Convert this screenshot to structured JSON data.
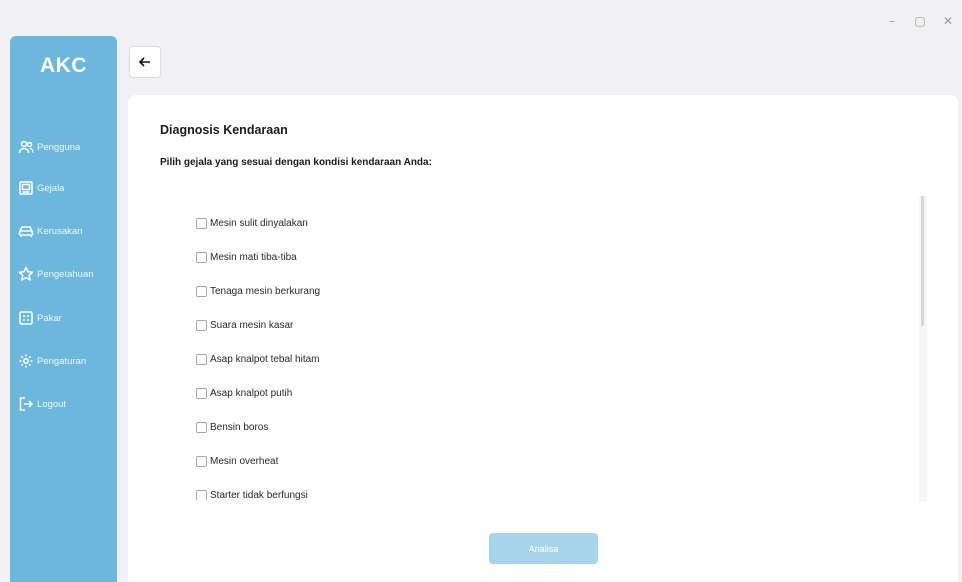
{
  "window": {
    "controls": [
      "–",
      "▢",
      "✕"
    ]
  },
  "sidebar": {
    "logo": "AKC",
    "items": [
      {
        "label": "Pengguna",
        "icon": "users-icon"
      },
      {
        "label": "Gejala",
        "icon": "clipboard-icon"
      },
      {
        "label": "Kerusakan",
        "icon": "car-icon"
      },
      {
        "label": "Pengetahuan",
        "icon": "star-icon"
      },
      {
        "label": "Pakar",
        "icon": "calculator-icon"
      },
      {
        "label": "Pengaturan",
        "icon": "gear-icon"
      },
      {
        "label": "Logout",
        "icon": "logout-icon"
      }
    ]
  },
  "main": {
    "title": "Diagnosis Kendaraan",
    "subtitle": "Pilih gejala yang sesuai dengan kondisi kendaraan Anda:",
    "symptoms": [
      {
        "label": "Mesin sulit dinyalakan",
        "checked": false
      },
      {
        "label": "Mesin mati tiba-tiba",
        "checked": false
      },
      {
        "label": "Tenaga mesin berkurang",
        "checked": false
      },
      {
        "label": "Suara mesin kasar",
        "checked": false
      },
      {
        "label": "Asap knalpot tebal hitam",
        "checked": false
      },
      {
        "label": "Asap knalpot putih",
        "checked": false
      },
      {
        "label": "Bensin boros",
        "checked": false
      },
      {
        "label": "Mesin overheat",
        "checked": false
      },
      {
        "label": "Starter tidak berfungsi",
        "checked": false
      }
    ],
    "analyze_label": "Analisa"
  },
  "colors": {
    "sidebar": "#6cb7dc",
    "button": "#a6d4ec",
    "background": "#f1f1f3"
  }
}
